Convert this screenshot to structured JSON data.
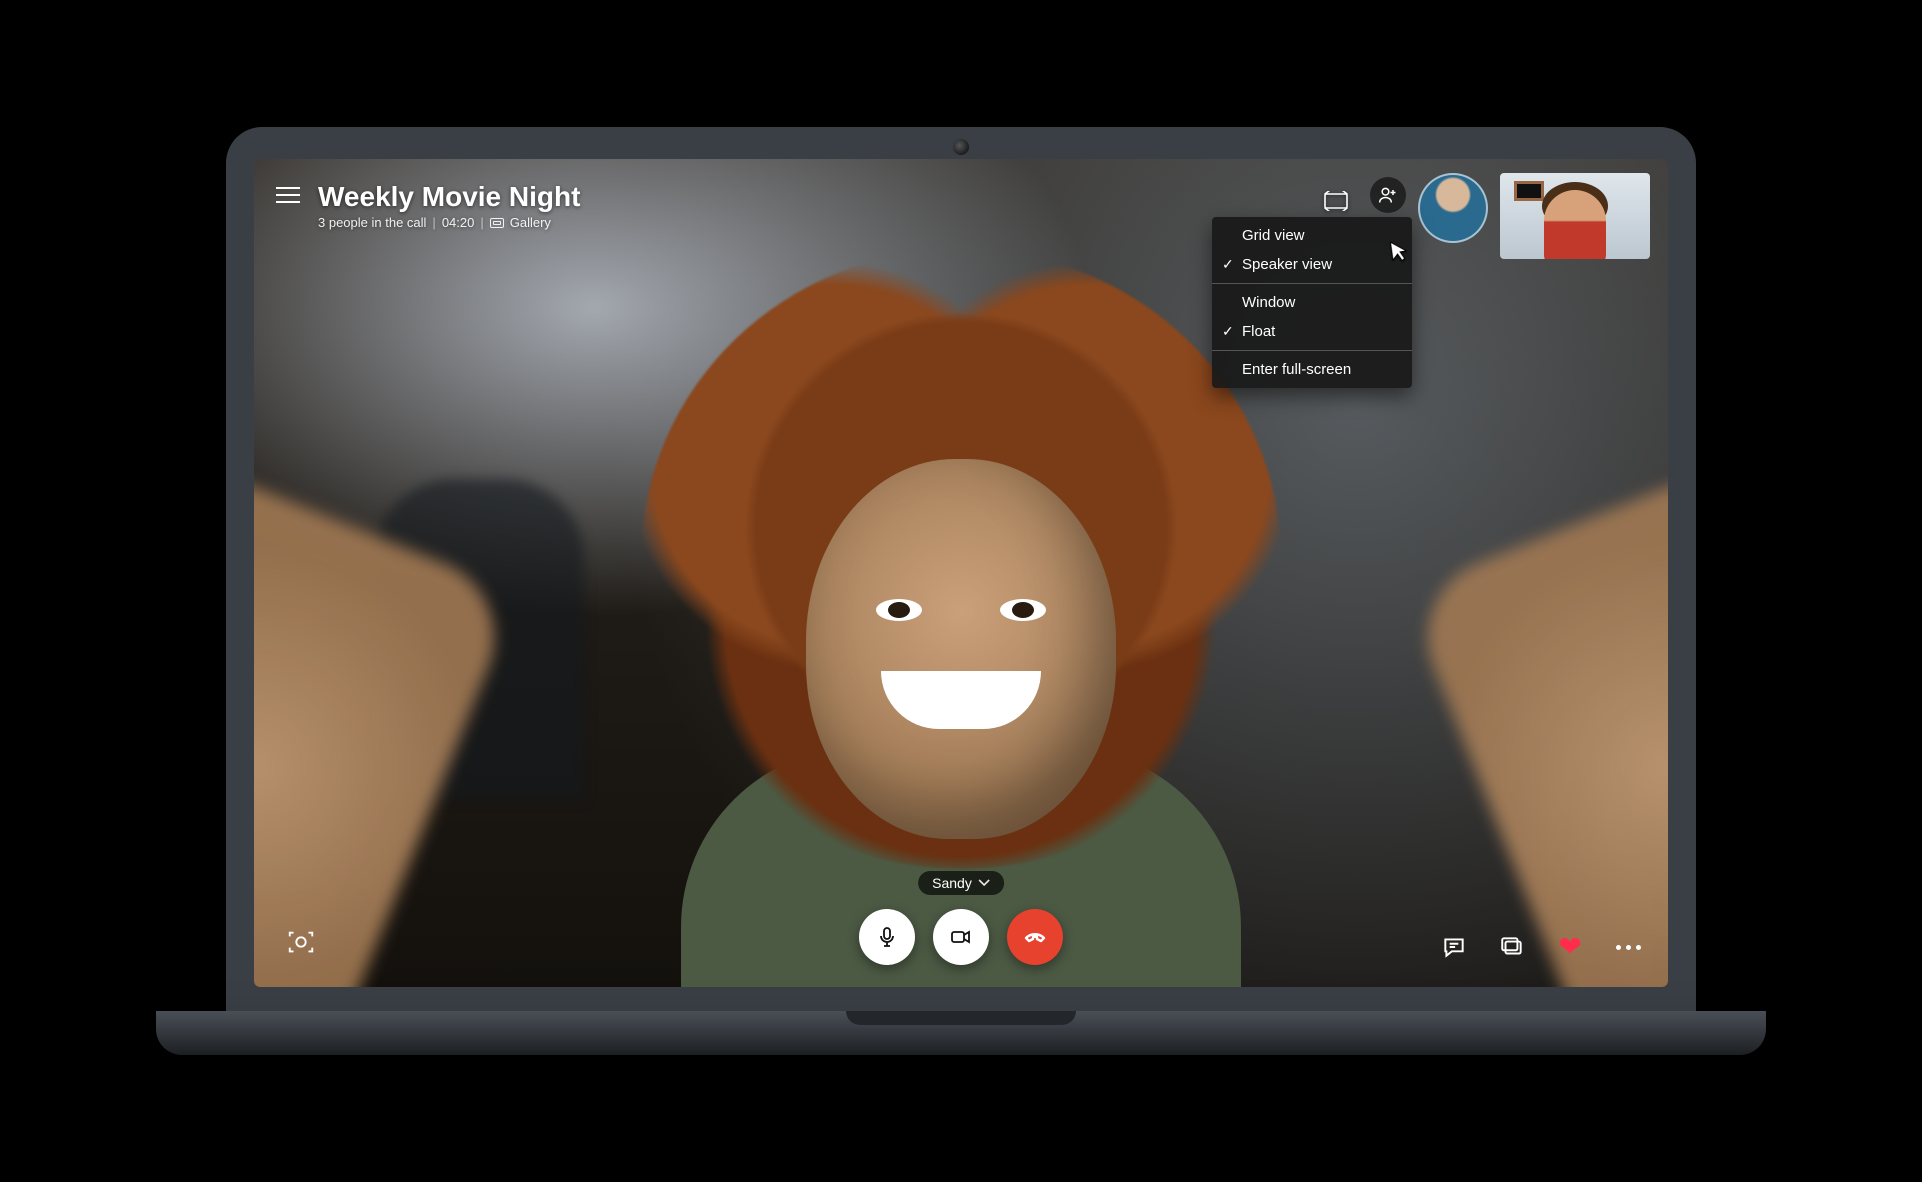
{
  "header": {
    "title": "Weekly Movie Night",
    "people_text": "3 people in the call",
    "duration": "04:20",
    "view_label": "Gallery"
  },
  "speaker": {
    "name": "Sandy"
  },
  "view_menu": {
    "grid": "Grid view",
    "speaker": "Speaker view",
    "window": "Window",
    "float": "Float",
    "fullscreen": "Enter full-screen",
    "selected_view": "speaker",
    "selected_window_mode": "float"
  },
  "icons": {
    "menu": "hamburger-icon",
    "layout": "layout-icon",
    "add_person": "add-participant-icon",
    "snapshot": "snapshot-icon",
    "mic": "microphone-icon",
    "video": "video-icon",
    "end": "end-call-icon",
    "chat": "chat-icon",
    "share": "share-screen-icon",
    "react_heart": "heart-reaction-icon",
    "more": "more-icon",
    "chevron_down": "chevron-down-icon"
  },
  "colors": {
    "end_call": "#e7422e",
    "heart": "#ff2d4b"
  }
}
